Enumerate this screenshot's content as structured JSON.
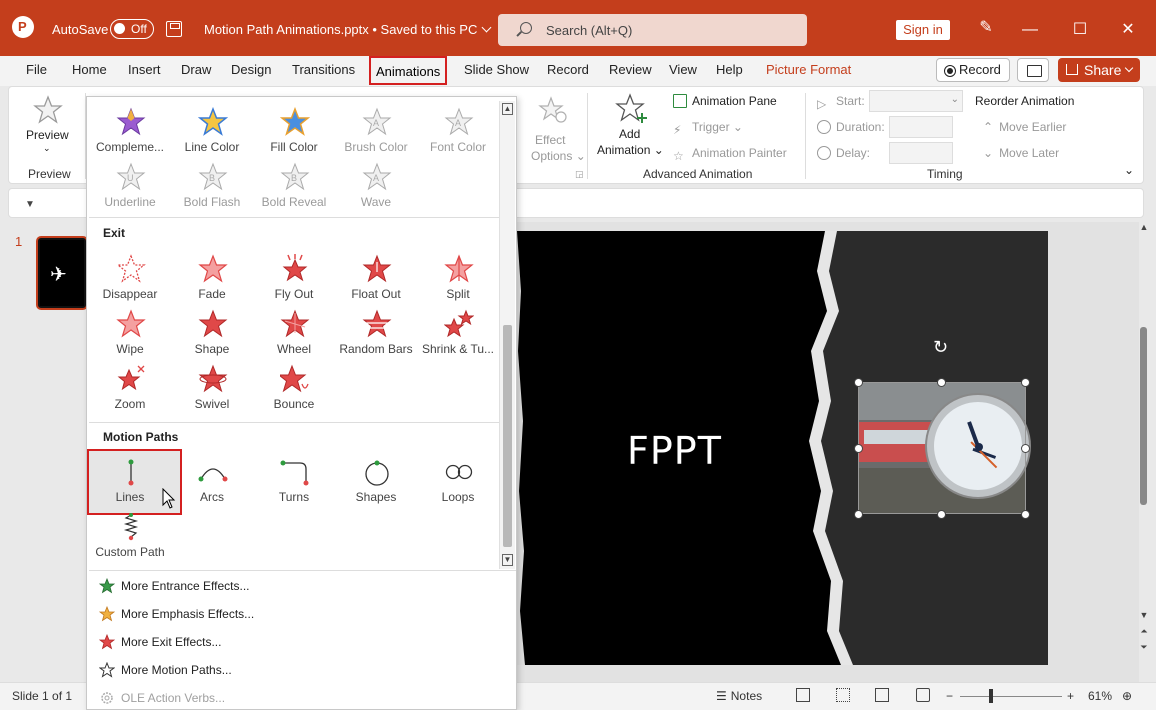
{
  "titlebar": {
    "autosave_label": "AutoSave",
    "toggle_text": "Off",
    "doc_title": "Motion Path Animations.pptx • Saved to this PC",
    "search_placeholder": "Search (Alt+Q)",
    "signin": "Sign in"
  },
  "menu": {
    "tabs": [
      "File",
      "Home",
      "Insert",
      "Draw",
      "Design",
      "Transitions",
      "Animations",
      "Slide Show",
      "Record",
      "Review",
      "View",
      "Help",
      "Picture Format"
    ],
    "record": "Record",
    "share": "Share"
  },
  "ribbon": {
    "preview": "Preview",
    "preview_group": "Preview",
    "effect_options": "Effect Options",
    "add_animation": "Add Animation",
    "animation_pane": "Animation Pane",
    "trigger": "Trigger",
    "animation_painter": "Animation Painter",
    "advanced_group": "Advanced Animation",
    "start": "Start:",
    "duration": "Duration:",
    "delay": "Delay:",
    "reorder": "Reorder Animation",
    "move_earlier": "Move Earlier",
    "move_later": "Move Later",
    "timing_group": "Timing"
  },
  "gallery": {
    "emphasis_row1": [
      "Compleme...",
      "Line Color",
      "Fill Color",
      "Brush Color",
      "Font Color"
    ],
    "emphasis_row2": [
      "Underline",
      "Bold Flash",
      "Bold Reveal",
      "Wave"
    ],
    "exit_header": "Exit",
    "exit_row1": [
      "Disappear",
      "Fade",
      "Fly Out",
      "Float Out",
      "Split"
    ],
    "exit_row2": [
      "Wipe",
      "Shape",
      "Wheel",
      "Random Bars",
      "Shrink & Tu..."
    ],
    "exit_row3": [
      "Zoom",
      "Swivel",
      "Bounce"
    ],
    "motion_header": "Motion Paths",
    "motion_row1": [
      "Lines",
      "Arcs",
      "Turns",
      "Shapes",
      "Loops"
    ],
    "motion_row2": [
      "Custom Path"
    ],
    "footer": [
      "More Entrance Effects...",
      "More Emphasis Effects...",
      "More Exit Effects...",
      "More Motion Paths...",
      "OLE Action Verbs..."
    ]
  },
  "slide": {
    "number": "1",
    "text": "FPPT"
  },
  "status": {
    "slide_of": "Slide 1 of 1",
    "notes": "Notes",
    "zoom": "61%"
  },
  "colors": {
    "brand": "#c43e1c",
    "highlight": "#d42020",
    "exit_star": "#e04848",
    "entrance_star": "#3a9b4a",
    "emphasis_star": "#e8a030"
  }
}
